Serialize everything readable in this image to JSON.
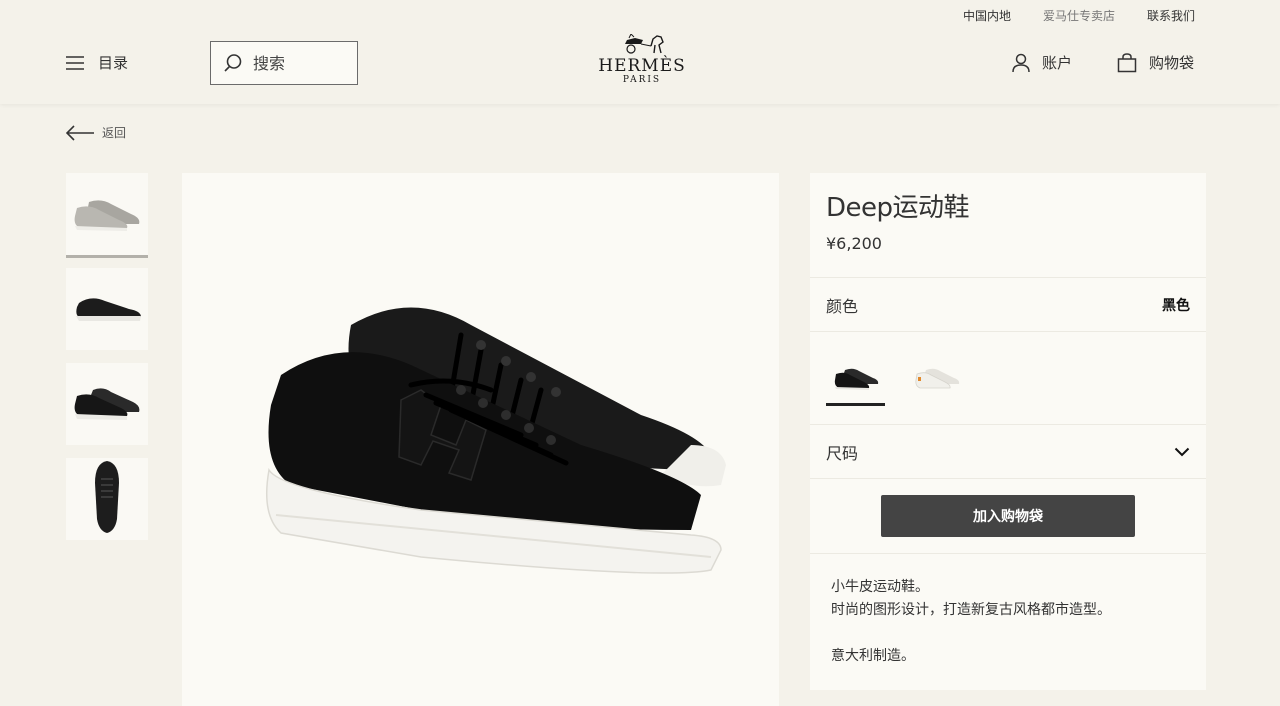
{
  "header": {
    "top_links": [
      "中国内地",
      "爱马仕专卖店",
      "联系我们"
    ],
    "menu_label": "目录",
    "search_placeholder": "搜索",
    "logo": {
      "brand": "HERMÈS",
      "city": "PARIS"
    },
    "account_label": "账户",
    "bag_label": "购物袋"
  },
  "nav": {
    "back_label": "返回"
  },
  "gallery": {
    "thumbnails": [
      "grey-sneaker-pair",
      "black-sneaker-side",
      "black-sneaker-pair",
      "black-sneaker-top"
    ],
    "active_thumbnail": 0,
    "main_image": "black-sneaker-pair"
  },
  "product": {
    "name": "Deep运动鞋",
    "price": "¥6,200",
    "color_label": "颜色",
    "color_value": "黑色",
    "swatches": [
      "black",
      "white"
    ],
    "size_label": "尺码",
    "add_to_bag": "加入购物袋",
    "description": [
      "小牛皮运动鞋。",
      "时尚的图形设计，打造新复古风格都市造型。",
      "意大利制造。"
    ]
  },
  "colors": {
    "background": "#f4f2ea",
    "panel": "#fbfaf5",
    "button": "#444444"
  }
}
